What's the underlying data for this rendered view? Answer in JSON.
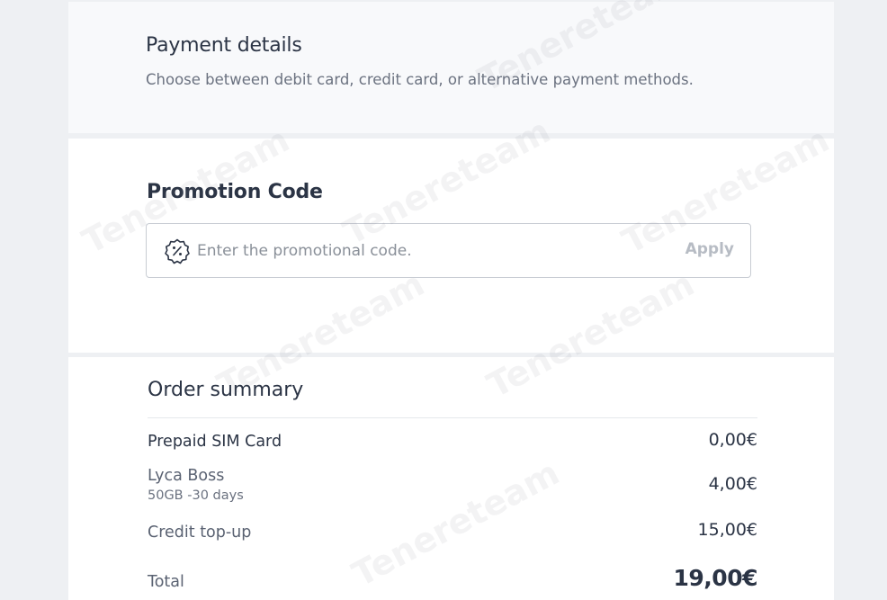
{
  "payment": {
    "title": "Payment details",
    "subtitle": "Choose between debit card, credit card, or alternative payment methods."
  },
  "promo": {
    "title": "Promotion Code",
    "placeholder": "Enter the promotional code.",
    "value": "",
    "apply_label": "Apply",
    "icon": "discount-badge-icon"
  },
  "order": {
    "title": "Order summary",
    "items": [
      {
        "label": "Prepaid SIM Card",
        "detail": "",
        "price": "0,00€"
      },
      {
        "label": "Lyca Boss",
        "detail": "50GB -30 days",
        "price": "4,00€"
      },
      {
        "label": "Credit top-up",
        "detail": "",
        "price": "15,00€"
      }
    ],
    "total_label": "Total",
    "total_price": "19,00€"
  },
  "watermark_text": "Tenereteam",
  "colors": {
    "text_primary": "#2b3445",
    "text_muted": "#6b7280",
    "apply_disabled": "#b7bcc4",
    "border": "#c8ccd3"
  }
}
